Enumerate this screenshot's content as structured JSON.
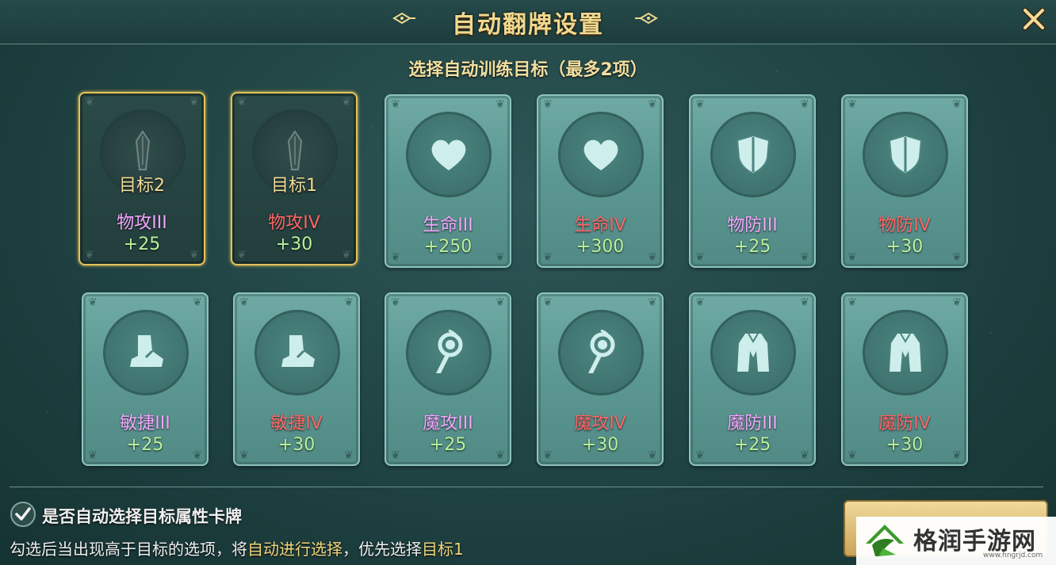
{
  "header": {
    "title": "自动翻牌设置",
    "close_icon": "close-icon"
  },
  "subtitle": "选择自动训练目标（最多2项）",
  "cards_row1": [
    {
      "goal": "目标2",
      "name": "物攻III",
      "value": "+25",
      "icon": "dagger-icon",
      "selected": true,
      "tier": "III"
    },
    {
      "goal": "目标1",
      "name": "物攻IV",
      "value": "+30",
      "icon": "dagger-icon",
      "selected": true,
      "tier": "IV"
    },
    {
      "goal": "",
      "name": "生命III",
      "value": "+250",
      "icon": "heart-icon",
      "selected": false,
      "tier": "III"
    },
    {
      "goal": "",
      "name": "生命IV",
      "value": "+300",
      "icon": "heart-icon",
      "selected": false,
      "tier": "IV"
    },
    {
      "goal": "",
      "name": "物防III",
      "value": "+25",
      "icon": "shield-icon",
      "selected": false,
      "tier": "III"
    },
    {
      "goal": "",
      "name": "物防IV",
      "value": "+30",
      "icon": "shield-icon",
      "selected": false,
      "tier": "IV"
    }
  ],
  "cards_row2": [
    {
      "name": "敏捷III",
      "value": "+25",
      "icon": "boot-icon",
      "tier": "III"
    },
    {
      "name": "敏捷IV",
      "value": "+30",
      "icon": "boot-icon",
      "tier": "IV"
    },
    {
      "name": "魔攻III",
      "value": "+25",
      "icon": "staff-icon",
      "tier": "III"
    },
    {
      "name": "魔攻IV",
      "value": "+30",
      "icon": "staff-icon",
      "tier": "IV"
    },
    {
      "name": "魔防III",
      "value": "+25",
      "icon": "robe-icon",
      "tier": "III"
    },
    {
      "name": "魔防IV",
      "value": "+30",
      "icon": "robe-icon",
      "tier": "IV"
    }
  ],
  "footer": {
    "auto_select_label": "是否自动选择目标属性卡牌",
    "auto_select_checked": true,
    "hint_part1": "勾选后当出现高于目标的选项，将",
    "hint_highlight1": "自动进行选择",
    "hint_part2": "，优先选择",
    "hint_highlight2": "目标1"
  },
  "watermark": {
    "text": "格润手游网",
    "url": "www.hngrjd.com"
  },
  "colors": {
    "tier_iii": "#f4a6ff",
    "tier_iv": "#ff6666",
    "value": "#b8f29a",
    "gold": "#f0d98f",
    "selected_border": "#e3c25a"
  }
}
